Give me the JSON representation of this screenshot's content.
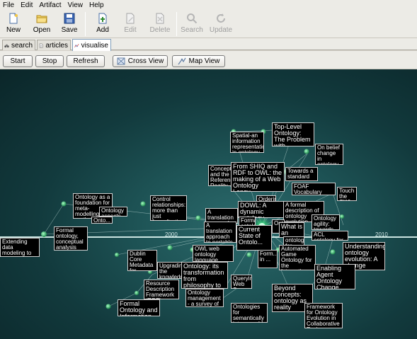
{
  "menu": [
    "File",
    "Edit",
    "Artifact",
    "View",
    "Help"
  ],
  "toolbar": {
    "new": "New",
    "open": "Open",
    "save": "Save",
    "add": "Add",
    "edit": "Edit",
    "delete": "Delete",
    "search": "Search",
    "update": "Update"
  },
  "tabs": [
    "search",
    "articles",
    "visualise"
  ],
  "viewbar": {
    "start": "Start",
    "stop": "Stop",
    "refresh": "Refresh",
    "cross_view": "Cross View",
    "map_view": "Map View"
  },
  "timeline": {
    "year_left": "2000",
    "year_right": "2010"
  },
  "nodes": [
    "Top-Level Ontology: The Problem with Naturalism",
    "Spatial-an information representation in ontology knowledge b...",
    "On belief change in ontology evolution",
    "Concepts and the Reference Reality",
    "From SHIQ and RDF to OWL: the making of a Web Ontology Langu...",
    "Towards a standard upper ontology",
    "FOAF Vocabulary Specification",
    "Touch the OWL",
    "Ontology as a foundation for meta-modelling and method engineer...",
    "Ontology aspects - An ...",
    "Onto...",
    "Control relationships: more than just formalisations for ...",
    "Ordering ...",
    "DOWL: A dynamic ontology language",
    "A formal description of ontology evolution ...",
    "A translation approach to portable ontology specification",
    "A translation approach to portable ontology specifications",
    "Ontology agility: towards ...",
    "ACL ontology for ...",
    "Formal ontology, conceptual analysis and knowle...",
    "Formal ontology conceptual and ...",
    "Current State of Ontolo...",
    "Onto...",
    "What is an ontology",
    "ontology for ...",
    "Extending data modeling to cover the whole enterprise",
    "Dublin Core Metadata for Resource Discovery",
    "Form... in ...",
    "OWL web ontology language ...",
    "Automated Game Ontology for the Interaction of Ontology ...",
    "Understanding ontology evolution: A change detect...",
    "Upgrading the knowledge integration and ...",
    "Ontology: its transformation from philosophy to information syst...",
    "Resource Description Framework (RDF) Model and Syntax",
    "Ontology management - a survey of exist...",
    "Querying Web Semantic ...",
    "Enabling Agent Ontology Change Management with Semantic Web-ba...",
    "Formal Ontology and Information Systems",
    "Beyond concepts: ontology as reality representat...",
    "Ontologies for semantically interoperable systems",
    "Framework for Ontology Evolution in Collaborative Environmen..."
  ]
}
